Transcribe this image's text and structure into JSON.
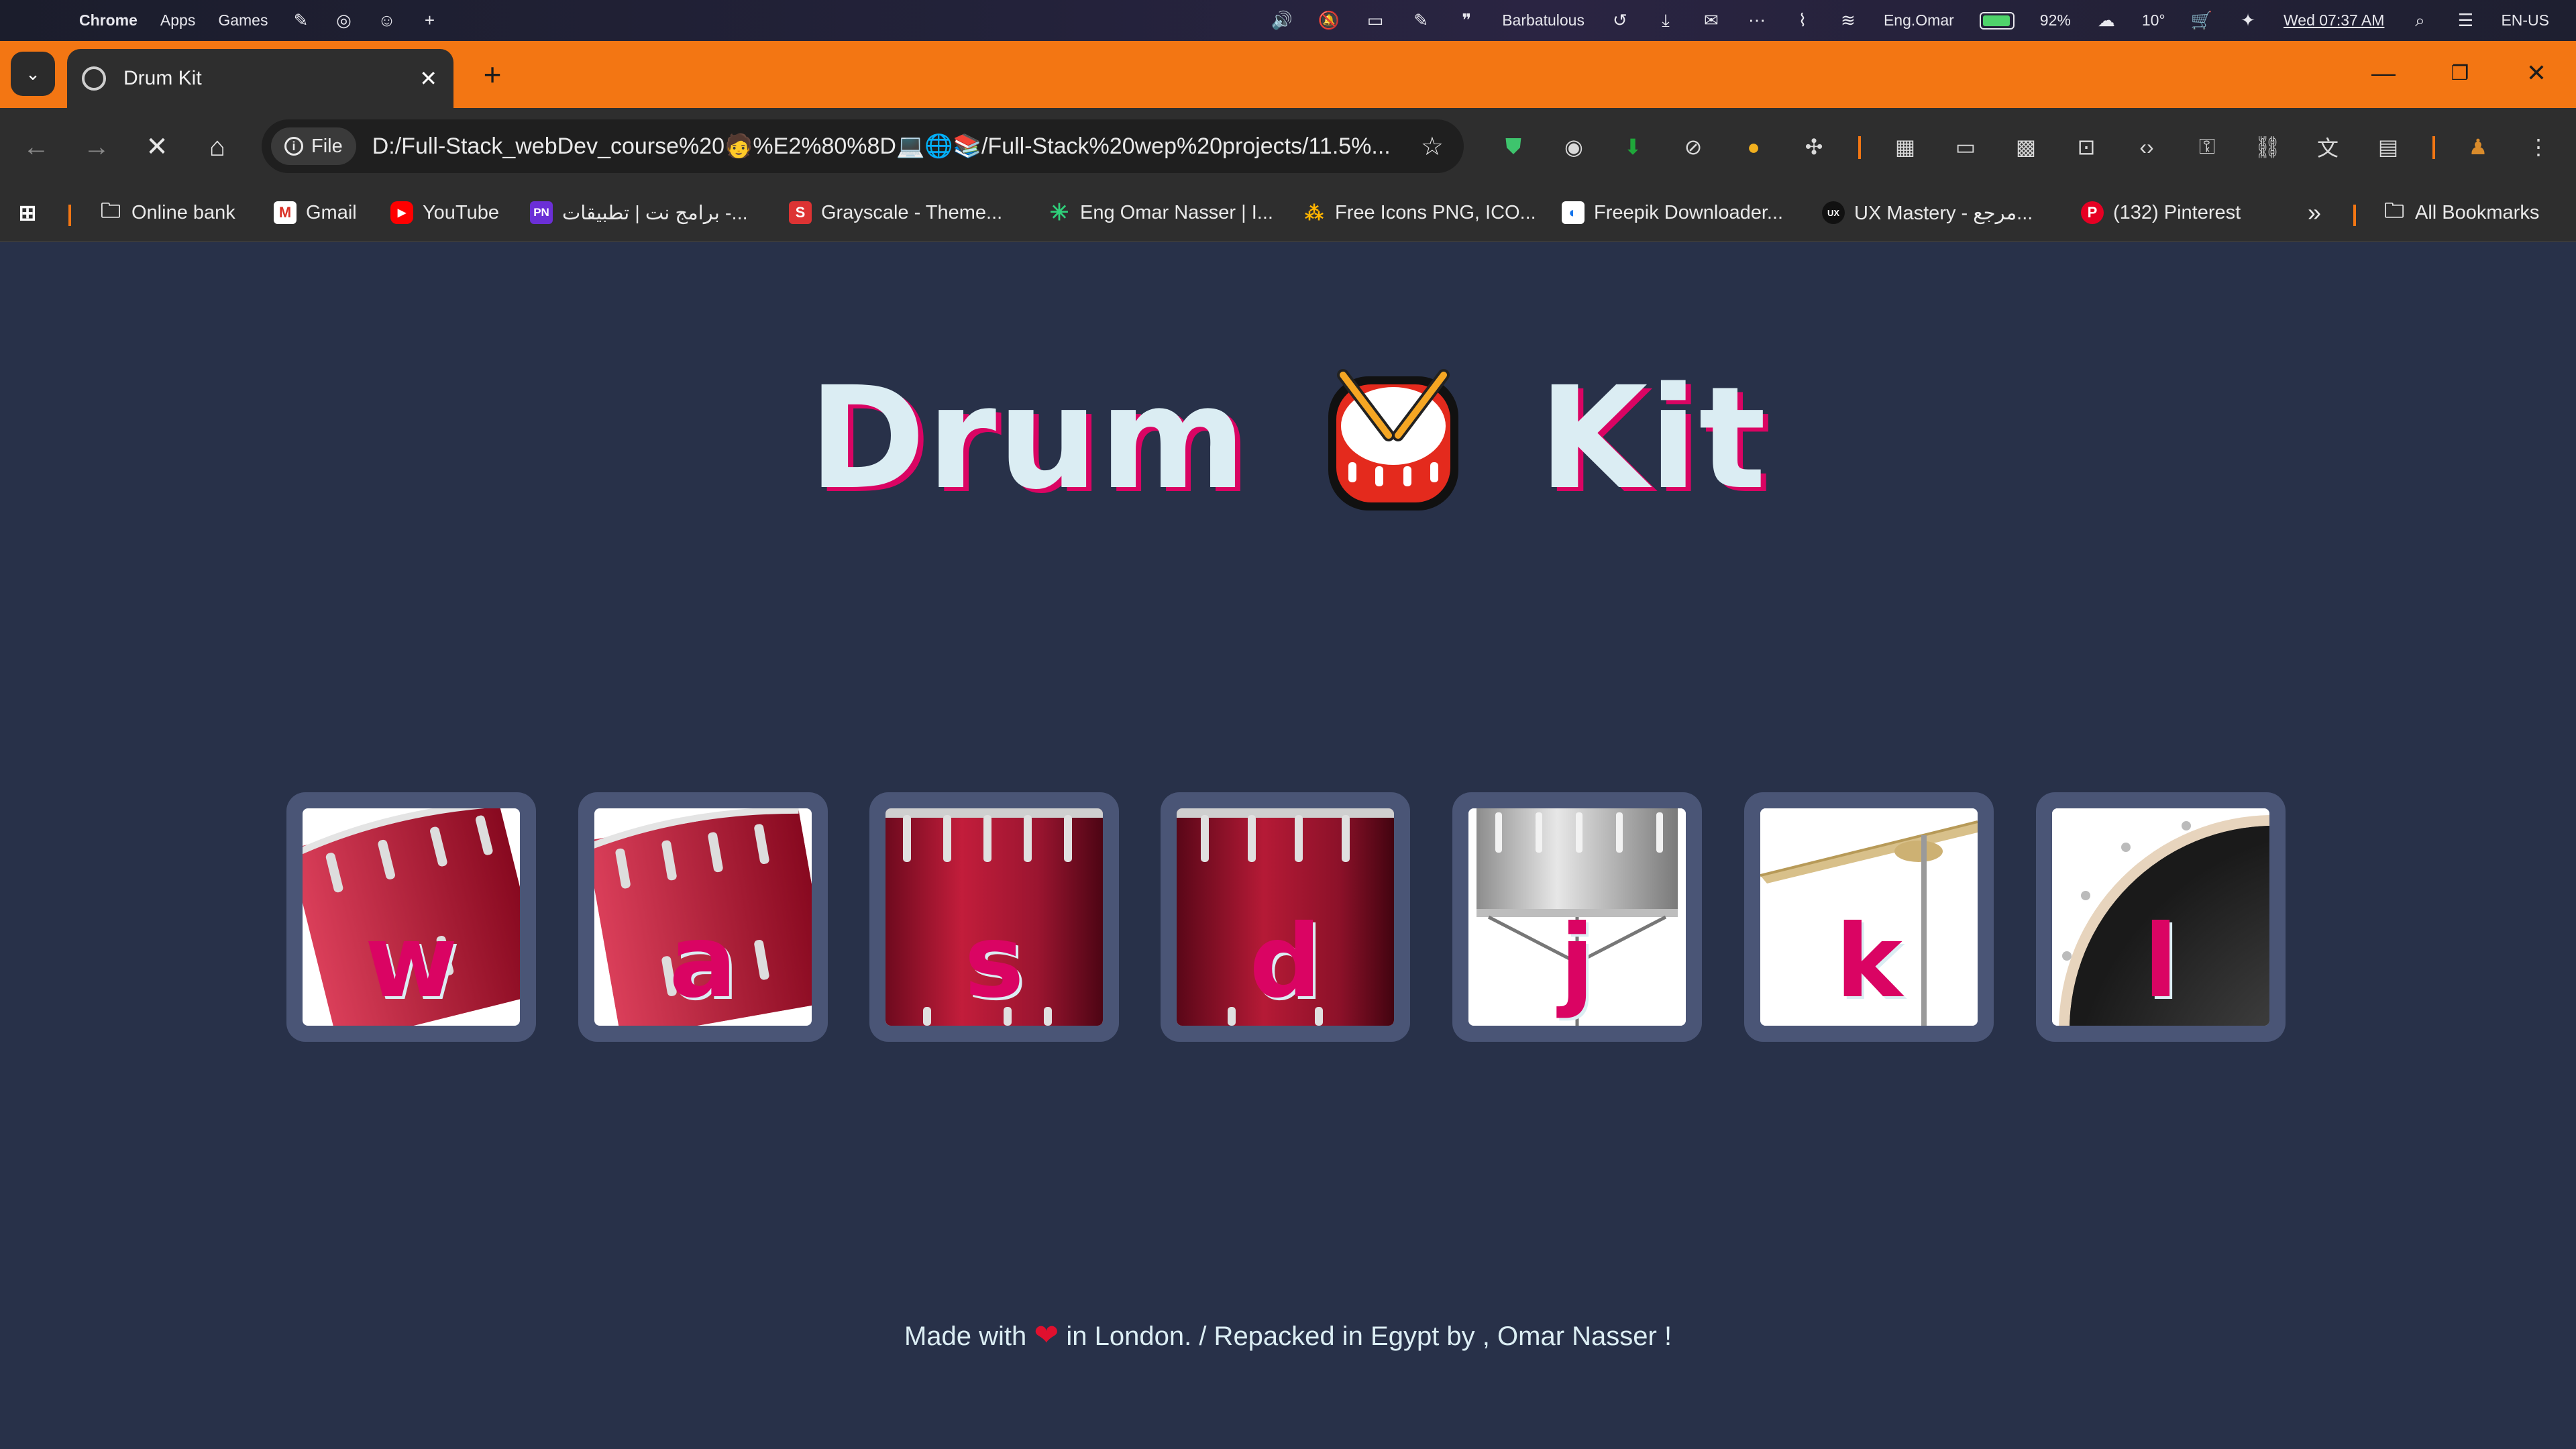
{
  "menubar": {
    "app_name": "Chrome",
    "menus": [
      "Apps",
      "Games"
    ],
    "user_label": "Barbatulous",
    "wifi_name": "Eng.Omar",
    "battery_percent": "92%",
    "temperature": "10°",
    "datetime": "Wed 07:37 AM",
    "input_language": "EN-US",
    "battery_level": 0.92
  },
  "tab": {
    "title": "Drum Kit",
    "close_glyph": "✕",
    "new_tab_glyph": "+",
    "menu_glyph": "⌄"
  },
  "window_controls": {
    "minimize": "—",
    "restore": "❐",
    "close": "✕"
  },
  "toolbar": {
    "back": "←",
    "forward": "→",
    "stop": "✕",
    "home": "⌂",
    "chip_label": "File",
    "url": "D:/Full-Stack_webDev_course%20🧑%E2%80%8D💻🌐📚/Full-Stack%20wep%20projects/11.5%...",
    "star": "☆"
  },
  "bookmarks": {
    "items": [
      {
        "label": "Online bank",
        "icon": "folder-icon"
      },
      {
        "label": "Gmail",
        "icon": "gmail-icon"
      },
      {
        "label": "YouTube",
        "icon": "youtube-icon"
      },
      {
        "label": "برامج نت | تطبيقات -...",
        "icon": "barmej-icon"
      },
      {
        "label": "Grayscale - Theme...",
        "icon": "startbootstrap-icon"
      },
      {
        "label": "Eng Omar Nasser | I...",
        "icon": "asterisk-icon"
      },
      {
        "label": "Free Icons PNG, ICO...",
        "icon": "icons-icon"
      },
      {
        "label": "Freepik Downloader...",
        "icon": "freepik-icon"
      },
      {
        "label": "UX Mastery - مرجع...",
        "icon": "uxmastery-icon"
      },
      {
        "label": "(132) Pinterest",
        "icon": "pinterest-icon"
      }
    ],
    "overflow": "»",
    "all_bookmarks": "All Bookmarks"
  },
  "page": {
    "title_left": "Drum",
    "title_right": "Kit",
    "drums": [
      {
        "key": "w",
        "instrument": "tom-1"
      },
      {
        "key": "a",
        "instrument": "tom-2"
      },
      {
        "key": "s",
        "instrument": "tom-3"
      },
      {
        "key": "d",
        "instrument": "tom-4"
      },
      {
        "key": "j",
        "instrument": "snare"
      },
      {
        "key": "k",
        "instrument": "crash"
      },
      {
        "key": "l",
        "instrument": "kick-bass"
      }
    ],
    "footer": {
      "before": "Made with",
      "heart": "❤",
      "after": "in London. / Repacked in Egypt by , Omar Nasser !"
    }
  },
  "colors": {
    "page_bg": "#283149",
    "accent": "#DA0463",
    "text_light": "#DBEDF3",
    "drum_frame": "#4A5576",
    "tab_strip": "#F37613"
  }
}
